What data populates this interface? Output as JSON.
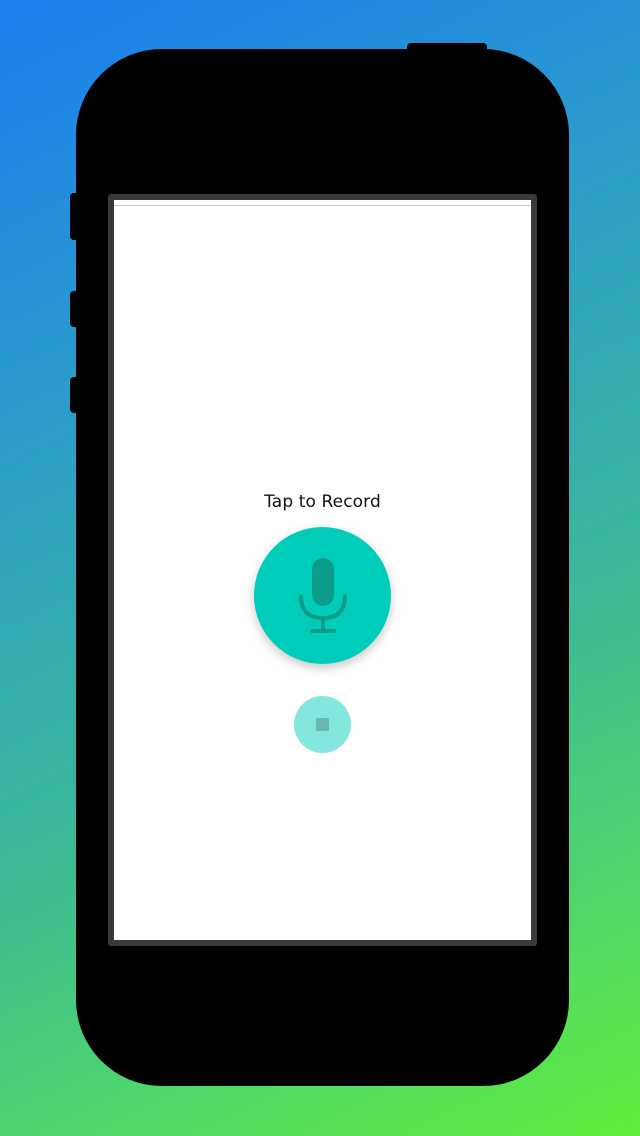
{
  "screen": {
    "prompt_text": "Tap to Record"
  },
  "controls": {
    "record_icon": "microphone-icon",
    "stop_icon": "stop-icon"
  },
  "colors": {
    "accent": "#00cdb9",
    "accent_disabled": "#84e7de",
    "icon": "#0b9d8a"
  }
}
